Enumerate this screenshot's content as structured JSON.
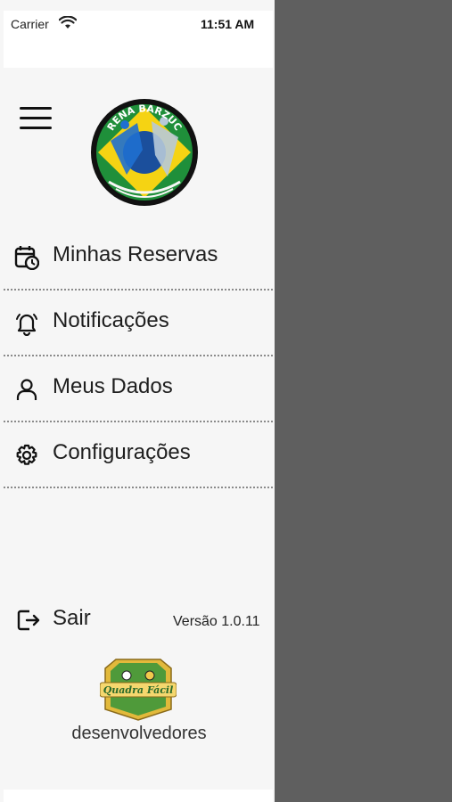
{
  "status_bar": {
    "carrier": "Carrier",
    "time": "11:51 AM"
  },
  "header": {
    "logo_text": "ARENA BARZUCA"
  },
  "menu": {
    "items": [
      {
        "label": "Minhas Reservas",
        "icon": "calendar-clock-icon"
      },
      {
        "label": "Notificações",
        "icon": "bell-icon"
      },
      {
        "label": "Meus Dados",
        "icon": "user-icon"
      },
      {
        "label": "Configurações",
        "icon": "gear-icon"
      }
    ]
  },
  "footer": {
    "logout_label": "Sair",
    "version": "Versão 1.0.11",
    "dev_logo_text": "Quadra Fácil",
    "dev_label": "desenvolvedores"
  },
  "colors": {
    "drawer_bg": "#f6f6f6",
    "overlay": "#5f5f5f",
    "brazil_green": "#1f8f3a",
    "brazil_yellow": "#f5d313",
    "brazil_blue": "#1b4f9c"
  }
}
